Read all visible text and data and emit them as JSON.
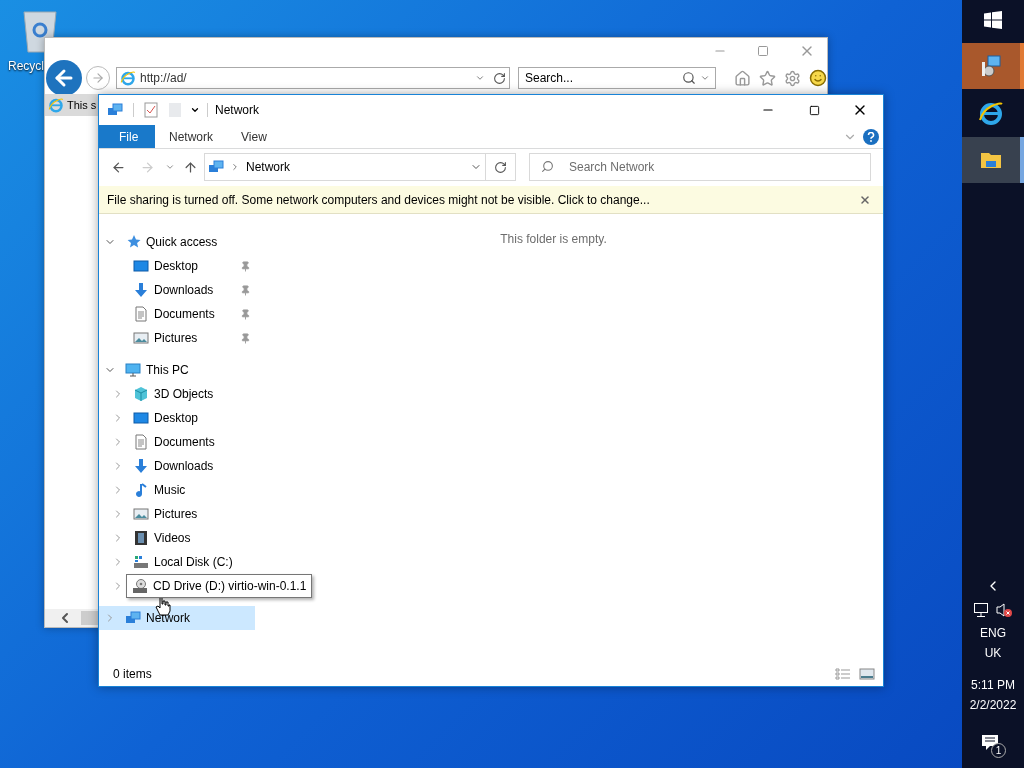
{
  "desktop": {
    "icons": [
      {
        "label": "Recycl"
      }
    ]
  },
  "browser": {
    "address": "http://ad/",
    "search_placeholder": "Search...",
    "tabs": [
      {
        "label": "This s",
        "selected": true
      }
    ]
  },
  "explorer": {
    "title": "Network",
    "ribbon_tabs": [
      {
        "label": "File",
        "selected": true
      },
      {
        "label": "Network",
        "selected": false
      },
      {
        "label": "View",
        "selected": false
      }
    ],
    "breadcrumb": [
      "Network"
    ],
    "search_placeholder": "Search Network",
    "infobar": "File sharing is turned off. Some network computers and devices might not be visible. Click to change...",
    "nav_tree": [
      {
        "label": "Quick access",
        "kind": "star",
        "expanded": true,
        "selected": false,
        "children": [
          {
            "label": "Desktop",
            "kind": "desktop",
            "pinned": true
          },
          {
            "label": "Downloads",
            "kind": "downloads",
            "pinned": true
          },
          {
            "label": "Documents",
            "kind": "documents",
            "pinned": true
          },
          {
            "label": "Pictures",
            "kind": "pictures",
            "pinned": true
          }
        ]
      },
      {
        "label": "This PC",
        "kind": "pc",
        "expanded": true,
        "selected": false,
        "children": [
          {
            "label": "3D Objects",
            "kind": "cube",
            "expanded": false
          },
          {
            "label": "Desktop",
            "kind": "desktop",
            "expanded": false
          },
          {
            "label": "Documents",
            "kind": "documents",
            "expanded": false
          },
          {
            "label": "Downloads",
            "kind": "downloads",
            "expanded": false
          },
          {
            "label": "Music",
            "kind": "music",
            "expanded": false
          },
          {
            "label": "Pictures",
            "kind": "pictures",
            "expanded": false
          },
          {
            "label": "Videos",
            "kind": "videos",
            "expanded": false
          },
          {
            "label": "Local Disk (C:)",
            "kind": "disk",
            "expanded": false
          },
          {
            "label": "CD Drive (D:) virtio-win-0.1.1",
            "kind": "cd",
            "expanded": false,
            "hovered": true
          }
        ]
      },
      {
        "label": "Network",
        "kind": "network",
        "expanded": false,
        "selected": true
      }
    ],
    "empty_message": "This folder is empty.",
    "status": "0 items"
  },
  "taskbar": {
    "apps": [
      {
        "kind": "installer",
        "flashing": true,
        "active": false
      },
      {
        "kind": "browser",
        "flashing": false,
        "active": false
      },
      {
        "kind": "folder",
        "flashing": false,
        "active": true
      }
    ],
    "language": "ENG",
    "region": "UK",
    "time": "5:11 PM",
    "date": "2/2/2022",
    "notification_count": "1",
    "volume_muted": true
  }
}
